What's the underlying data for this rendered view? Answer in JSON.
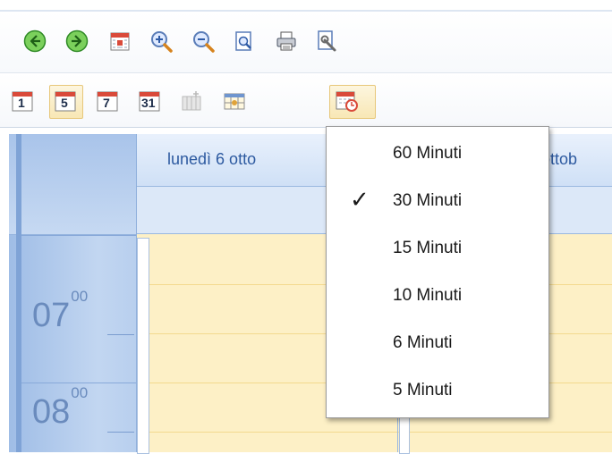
{
  "toolbar_main": {
    "buttons": [
      {
        "name": "back-button",
        "icon": "arrow-left-circle-icon"
      },
      {
        "name": "forward-button",
        "icon": "arrow-right-circle-icon"
      },
      {
        "name": "today-button",
        "icon": "calendar-today-icon"
      },
      {
        "name": "zoom-in-button",
        "icon": "zoom-in-icon"
      },
      {
        "name": "zoom-out-button",
        "icon": "zoom-out-icon"
      },
      {
        "name": "print-preview-button",
        "icon": "print-preview-icon"
      },
      {
        "name": "print-button",
        "icon": "printer-icon"
      },
      {
        "name": "page-setup-button",
        "icon": "page-setup-icon"
      }
    ]
  },
  "toolbar_view": {
    "day_label": "1",
    "workweek_label": "5",
    "week_label": "7",
    "month_label": "31"
  },
  "calendar": {
    "day1_header": "lunedì 6 otto",
    "day2_header": "ottob",
    "hours": [
      {
        "hour": "07",
        "minutes": "00"
      },
      {
        "hour": "08",
        "minutes": "00"
      }
    ]
  },
  "time_scale_menu": {
    "items": [
      {
        "label": "60 Minuti",
        "checked": false
      },
      {
        "label": "30 Minuti",
        "checked": true
      },
      {
        "label": "15 Minuti",
        "checked": false
      },
      {
        "label": "10 Minuti",
        "checked": false
      },
      {
        "label": "6 Minuti",
        "checked": false
      },
      {
        "label": "5 Minuti",
        "checked": false
      }
    ],
    "check_glyph": "✓"
  },
  "colors": {
    "accent_blue": "#2d5aa0",
    "slot_yellow": "#fdf0c6",
    "green_nav": "#4caf3c"
  }
}
